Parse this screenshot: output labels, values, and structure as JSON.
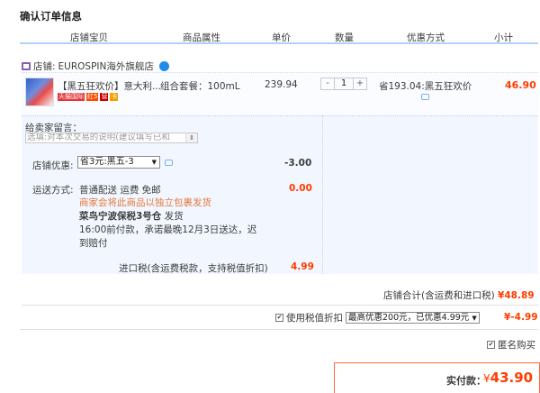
{
  "page_title": "确认订单信息",
  "columns": [
    "店铺宝贝",
    "商品属性",
    "单价",
    "数量",
    "优惠方式",
    "小计"
  ],
  "shop": {
    "label": "店铺:",
    "name": "EUROSPIN海外旗舰店"
  },
  "item": {
    "name": "【黑五狂欢价】意大利...",
    "props": "组合套餐：100mL",
    "price": "239.94",
    "quantity": "1",
    "qty_minus": "-",
    "qty_plus": "+",
    "promo": "省193.04:黑五狂欢价",
    "subtotal": "46.90",
    "badges": [
      "天猫国际",
      "红5",
      "营",
      "卡"
    ]
  },
  "message": {
    "label": "给卖家留言：",
    "placeholder": "选填:对本次交易的说明(建议填写已和"
  },
  "shop_discount": {
    "label": "店铺优惠:",
    "selected": "省3元:黑五-3",
    "value": "-3.00"
  },
  "shipping": {
    "label": "运送方式:",
    "line1": "普通配送 运费 免邮",
    "line2": "商家会将此商品以独立包裹发货",
    "line3": "菜鸟宁波保税3号仓",
    "line3b": "发货",
    "line4": "16:00前付款，承诺最晚12月3日送达，迟",
    "line5": "到赔付",
    "value": "0.00"
  },
  "import_tax": {
    "label": "进口税(含运费税款，支持税值折扣)",
    "value": "4.99"
  },
  "shop_total": {
    "label": "店铺合计(含运费和进口税)",
    "value": "¥48.89"
  },
  "tax_coupon": {
    "label": "使用税值折扣",
    "selected": "最高优惠200元，已优惠4.99元",
    "value": "¥-4.99"
  },
  "anonymous": {
    "label": "匿名购买"
  },
  "payment": {
    "label": "实付款：",
    "currency": "¥",
    "value": "43.90"
  },
  "colors": {
    "accent": "#ff3c00",
    "header_line": "#b2d1ff",
    "panel_bg": "#f2f7ff"
  }
}
